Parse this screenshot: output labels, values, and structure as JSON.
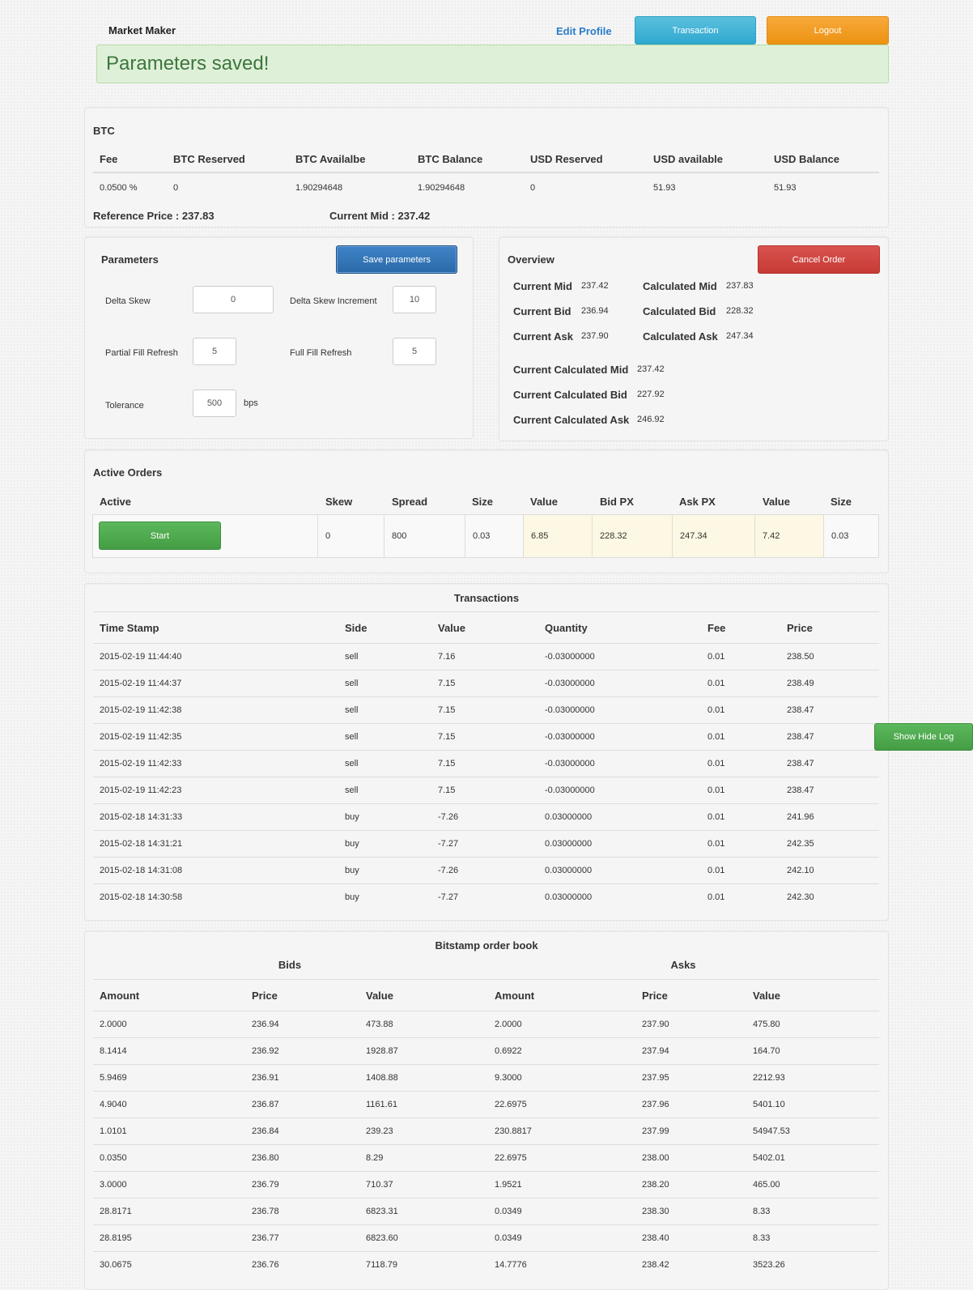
{
  "header": {
    "brand": "Market Maker",
    "edit_profile": "Edit Profile",
    "transaction_button": "Transaction",
    "logout_button": "Logout"
  },
  "alert": {
    "message": "Parameters saved!"
  },
  "btc": {
    "title": "BTC",
    "columns": [
      "Fee",
      "BTC Reserved",
      "BTC Availalbe",
      "BTC Balance",
      "USD Reserved",
      "USD available",
      "USD Balance"
    ],
    "values": [
      "0.0500 %",
      "0",
      "1.90294648",
      "1.90294648",
      "0",
      "51.93",
      "51.93"
    ],
    "reference_price": "Reference Price : 237.83",
    "current_mid": "Current Mid : 237.42"
  },
  "parameters": {
    "title": "Parameters",
    "save_button": "Save parameters",
    "delta_skew_label": "Delta Skew",
    "delta_skew_value": "0",
    "delta_skew_increment_label": "Delta Skew Increment",
    "delta_skew_increment_value": "10",
    "partial_fill_label": "Partial Fill Refresh",
    "partial_fill_value": "5",
    "full_fill_label": "Full Fill Refresh",
    "full_fill_value": "5",
    "tolerance_label": "Tolerance",
    "tolerance_value": "500",
    "tolerance_unit": "bps"
  },
  "overview": {
    "title": "Overview",
    "cancel_button": "Cancel Order",
    "current_mid_label": "Current Mid",
    "current_mid": "237.42",
    "current_bid_label": "Current Bid",
    "current_bid": "236.94",
    "current_ask_label": "Current Ask",
    "current_ask": "237.90",
    "calc_mid_label": "Calculated Mid",
    "calc_mid": "237.83",
    "calc_bid_label": "Calculated Bid",
    "calc_bid": "228.32",
    "calc_ask_label": "Calculated Ask",
    "calc_ask": "247.34",
    "cur_calc_mid_label": "Current Calculated Mid",
    "cur_calc_mid": "237.42",
    "cur_calc_bid_label": "Current Calculated Bid",
    "cur_calc_bid": "227.92",
    "cur_calc_ask_label": "Current Calculated Ask",
    "cur_calc_ask": "246.92"
  },
  "active_orders": {
    "title": "Active Orders",
    "columns": [
      "Active",
      "Skew",
      "Spread",
      "Size",
      "Value",
      "Bid PX",
      "Ask PX",
      "Value",
      "Size"
    ],
    "start_button": "Start",
    "row": [
      "0",
      "800",
      "0.03",
      "6.85",
      "228.32",
      "247.34",
      "7.42",
      "0.03"
    ]
  },
  "transactions": {
    "title": "Transactions",
    "columns": [
      "Time Stamp",
      "Side",
      "Value",
      "Quantity",
      "Fee",
      "Price"
    ],
    "rows": [
      [
        "2015-02-19 11:44:40",
        "sell",
        "7.16",
        "-0.03000000",
        "0.01",
        "238.50"
      ],
      [
        "2015-02-19 11:44:37",
        "sell",
        "7.15",
        "-0.03000000",
        "0.01",
        "238.49"
      ],
      [
        "2015-02-19 11:42:38",
        "sell",
        "7.15",
        "-0.03000000",
        "0.01",
        "238.47"
      ],
      [
        "2015-02-19 11:42:35",
        "sell",
        "7.15",
        "-0.03000000",
        "0.01",
        "238.47"
      ],
      [
        "2015-02-19 11:42:33",
        "sell",
        "7.15",
        "-0.03000000",
        "0.01",
        "238.47"
      ],
      [
        "2015-02-19 11:42:23",
        "sell",
        "7.15",
        "-0.03000000",
        "0.01",
        "238.47"
      ],
      [
        "2015-02-18 14:31:33",
        "buy",
        "-7.26",
        "0.03000000",
        "0.01",
        "241.96"
      ],
      [
        "2015-02-18 14:31:21",
        "buy",
        "-7.27",
        "0.03000000",
        "0.01",
        "242.35"
      ],
      [
        "2015-02-18 14:31:08",
        "buy",
        "-7.26",
        "0.03000000",
        "0.01",
        "242.10"
      ],
      [
        "2015-02-18 14:30:58",
        "buy",
        "-7.27",
        "0.03000000",
        "0.01",
        "242.30"
      ]
    ]
  },
  "orderbook": {
    "title": "Bitstamp order book",
    "bids_title": "Bids",
    "asks_title": "Asks",
    "columns": [
      "Amount",
      "Price",
      "Value",
      "Amount",
      "Price",
      "Value"
    ],
    "rows": [
      [
        "2.0000",
        "236.94",
        "473.88",
        "2.0000",
        "237.90",
        "475.80"
      ],
      [
        "8.1414",
        "236.92",
        "1928.87",
        "0.6922",
        "237.94",
        "164.70"
      ],
      [
        "5.9469",
        "236.91",
        "1408.88",
        "9.3000",
        "237.95",
        "2212.93"
      ],
      [
        "4.9040",
        "236.87",
        "1161.61",
        "22.6975",
        "237.96",
        "5401.10"
      ],
      [
        "1.0101",
        "236.84",
        "239.23",
        "230.8817",
        "237.99",
        "54947.53"
      ],
      [
        "0.0350",
        "236.80",
        "8.29",
        "22.6975",
        "238.00",
        "5402.01"
      ],
      [
        "3.0000",
        "236.79",
        "710.37",
        "1.9521",
        "238.20",
        "465.00"
      ],
      [
        "28.8171",
        "236.78",
        "6823.31",
        "0.0349",
        "238.30",
        "8.33"
      ],
      [
        "28.8195",
        "236.77",
        "6823.60",
        "0.0349",
        "238.40",
        "8.33"
      ],
      [
        "30.0675",
        "236.76",
        "7118.79",
        "14.7776",
        "238.42",
        "3523.26"
      ]
    ]
  },
  "show_hide_log": "Show Hide Log"
}
